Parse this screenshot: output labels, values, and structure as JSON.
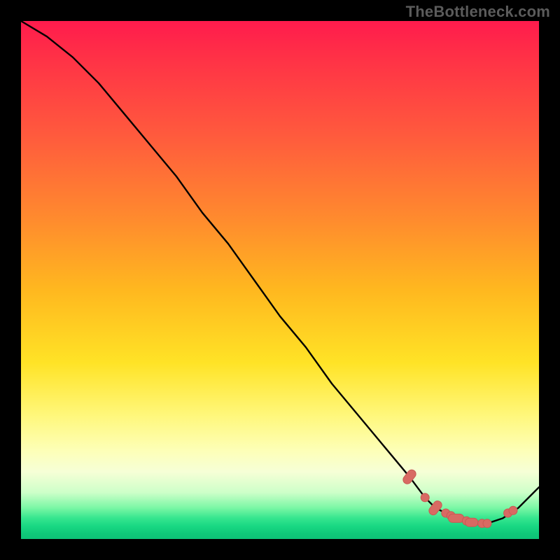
{
  "watermark": "TheBottleneck.com",
  "colors": {
    "background": "#000000",
    "gradient_top": "#ff1b4d",
    "gradient_mid": "#ffe326",
    "gradient_bottom": "#0ec277",
    "curve": "#000000",
    "marker": "#d86a63"
  },
  "chart_data": {
    "type": "line",
    "title": "",
    "xlabel": "",
    "ylabel": "",
    "xlim": [
      0,
      100
    ],
    "ylim": [
      0,
      100
    ],
    "grid": false,
    "x": [
      0,
      5,
      10,
      15,
      20,
      25,
      30,
      35,
      40,
      45,
      50,
      55,
      60,
      65,
      70,
      75,
      78,
      80,
      82,
      85,
      88,
      90,
      93,
      96,
      100
    ],
    "values": [
      100,
      97,
      93,
      88,
      82,
      76,
      70,
      63,
      57,
      50,
      43,
      37,
      30,
      24,
      18,
      12,
      8,
      6,
      5,
      4,
      3,
      3,
      4,
      6,
      10
    ],
    "markers": [
      {
        "x": 75,
        "y": 12,
        "shape": "pill",
        "len": 3
      },
      {
        "x": 78,
        "y": 8,
        "shape": "dot"
      },
      {
        "x": 80,
        "y": 6,
        "shape": "pill",
        "len": 3
      },
      {
        "x": 82,
        "y": 5,
        "shape": "dot"
      },
      {
        "x": 83,
        "y": 4.5,
        "shape": "dot"
      },
      {
        "x": 84,
        "y": 4,
        "shape": "pill",
        "len": 3
      },
      {
        "x": 86,
        "y": 3.5,
        "shape": "dot"
      },
      {
        "x": 87,
        "y": 3.2,
        "shape": "pill",
        "len": 2.5
      },
      {
        "x": 89,
        "y": 3,
        "shape": "dot"
      },
      {
        "x": 90,
        "y": 3,
        "shape": "dot"
      },
      {
        "x": 94,
        "y": 5,
        "shape": "dot"
      },
      {
        "x": 95,
        "y": 5.5,
        "shape": "dot"
      }
    ]
  }
}
